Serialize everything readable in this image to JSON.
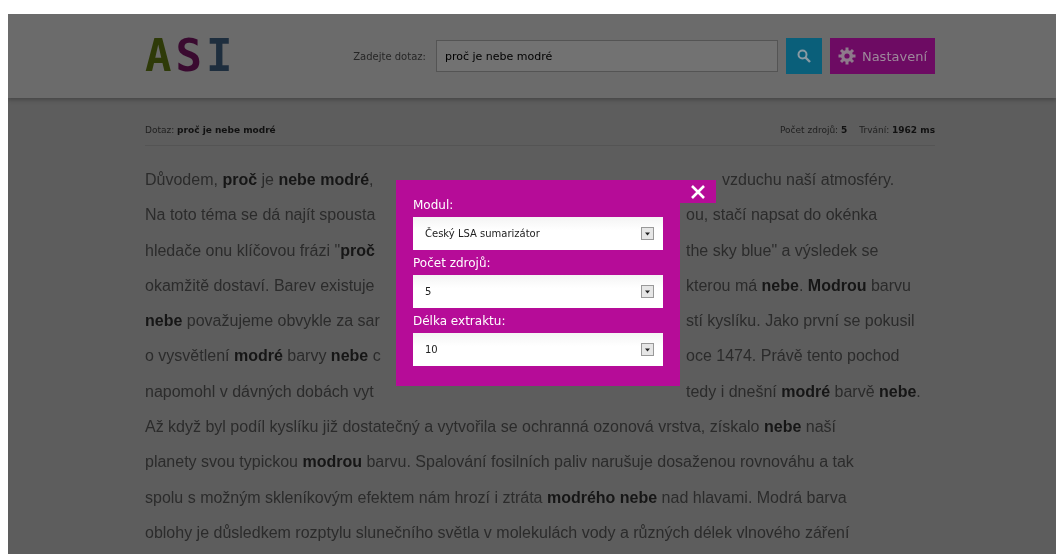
{
  "header": {
    "logo": "ASI",
    "search": {
      "label": "Zadejte dotaz:",
      "value": "proč je nebe modré"
    },
    "settings_button": "Nastavení"
  },
  "meta": {
    "query_label": "Dotaz:",
    "query": "proč je nebe modré",
    "stats": [
      {
        "label": "Počet zdrojů:",
        "value": "5"
      },
      {
        "label": "Trvání:",
        "value": "1962 ms"
      }
    ]
  },
  "article_lines": [
    {
      "left": "Důvodem, **proč** je **nebe modré**,",
      "right": "vzduchu naší atmosféry."
    },
    {
      "left": "Na toto téma se dá najít spousta",
      "right": "ou, stačí napsat do okénka"
    },
    {
      "left": "hledače onu klíčovou frázi \"**proč**",
      "right": "the sky blue\" a výsledek se"
    },
    {
      "left": "okamžitě dostaví. Barev existuje",
      "right": "kterou má **nebe**. **Modrou** barvu"
    },
    {
      "left": "**nebe** považujeme obvykle za sar",
      "right": "stí kyslíku. Jako první se pokusil"
    },
    {
      "left": "o vysvětlení **modré** barvy **nebe** c",
      "right": "oce 1474. Právě tento pochod"
    },
    {
      "left": "napomohl v dávných dobách vyt",
      "right": "tedy i dnešní **modré** barvě **nebe**."
    },
    {
      "left": "Až když byl podíl kyslíku již dostatečný a vytvořila se ochranná ozonová vrstva, získalo **nebe** naší"
    },
    {
      "left": "planety svou typickou **modrou** barvu. Spalování fosilních paliv narušuje dosaženou rovnováhu a tak"
    },
    {
      "left": "spolu s možným skleníkovým efektem nám hrozí i ztráta **modrého nebe** nad hlavami. Modrá barva"
    },
    {
      "left": "oblohy je důsledkem rozptylu slunečního světla v molekulách vody a různých délek vlnového záření"
    }
  ],
  "settings_dialog": {
    "fields": [
      {
        "label": "Modul:",
        "value": "Český LSA sumarizátor"
      },
      {
        "label": "Počet zdrojů:",
        "value": "5"
      },
      {
        "label": "Délka extraktu:",
        "value": "10"
      }
    ]
  }
}
